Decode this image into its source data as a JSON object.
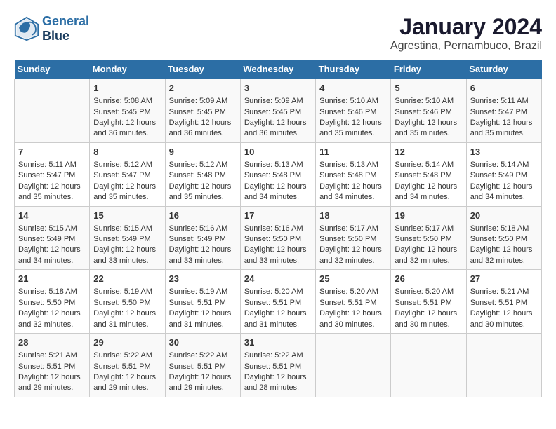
{
  "header": {
    "logo_line1": "General",
    "logo_line2": "Blue",
    "month_year": "January 2024",
    "location": "Agrestina, Pernambuco, Brazil"
  },
  "days_of_week": [
    "Sunday",
    "Monday",
    "Tuesday",
    "Wednesday",
    "Thursday",
    "Friday",
    "Saturday"
  ],
  "weeks": [
    [
      {
        "day": "",
        "info": ""
      },
      {
        "day": "1",
        "sunrise": "Sunrise: 5:08 AM",
        "sunset": "Sunset: 5:45 PM",
        "daylight": "Daylight: 12 hours and 36 minutes."
      },
      {
        "day": "2",
        "sunrise": "Sunrise: 5:09 AM",
        "sunset": "Sunset: 5:45 PM",
        "daylight": "Daylight: 12 hours and 36 minutes."
      },
      {
        "day": "3",
        "sunrise": "Sunrise: 5:09 AM",
        "sunset": "Sunset: 5:45 PM",
        "daylight": "Daylight: 12 hours and 36 minutes."
      },
      {
        "day": "4",
        "sunrise": "Sunrise: 5:10 AM",
        "sunset": "Sunset: 5:46 PM",
        "daylight": "Daylight: 12 hours and 35 minutes."
      },
      {
        "day": "5",
        "sunrise": "Sunrise: 5:10 AM",
        "sunset": "Sunset: 5:46 PM",
        "daylight": "Daylight: 12 hours and 35 minutes."
      },
      {
        "day": "6",
        "sunrise": "Sunrise: 5:11 AM",
        "sunset": "Sunset: 5:47 PM",
        "daylight": "Daylight: 12 hours and 35 minutes."
      }
    ],
    [
      {
        "day": "7",
        "sunrise": "Sunrise: 5:11 AM",
        "sunset": "Sunset: 5:47 PM",
        "daylight": "Daylight: 12 hours and 35 minutes."
      },
      {
        "day": "8",
        "sunrise": "Sunrise: 5:12 AM",
        "sunset": "Sunset: 5:47 PM",
        "daylight": "Daylight: 12 hours and 35 minutes."
      },
      {
        "day": "9",
        "sunrise": "Sunrise: 5:12 AM",
        "sunset": "Sunset: 5:48 PM",
        "daylight": "Daylight: 12 hours and 35 minutes."
      },
      {
        "day": "10",
        "sunrise": "Sunrise: 5:13 AM",
        "sunset": "Sunset: 5:48 PM",
        "daylight": "Daylight: 12 hours and 34 minutes."
      },
      {
        "day": "11",
        "sunrise": "Sunrise: 5:13 AM",
        "sunset": "Sunset: 5:48 PM",
        "daylight": "Daylight: 12 hours and 34 minutes."
      },
      {
        "day": "12",
        "sunrise": "Sunrise: 5:14 AM",
        "sunset": "Sunset: 5:48 PM",
        "daylight": "Daylight: 12 hours and 34 minutes."
      },
      {
        "day": "13",
        "sunrise": "Sunrise: 5:14 AM",
        "sunset": "Sunset: 5:49 PM",
        "daylight": "Daylight: 12 hours and 34 minutes."
      }
    ],
    [
      {
        "day": "14",
        "sunrise": "Sunrise: 5:15 AM",
        "sunset": "Sunset: 5:49 PM",
        "daylight": "Daylight: 12 hours and 34 minutes."
      },
      {
        "day": "15",
        "sunrise": "Sunrise: 5:15 AM",
        "sunset": "Sunset: 5:49 PM",
        "daylight": "Daylight: 12 hours and 33 minutes."
      },
      {
        "day": "16",
        "sunrise": "Sunrise: 5:16 AM",
        "sunset": "Sunset: 5:49 PM",
        "daylight": "Daylight: 12 hours and 33 minutes."
      },
      {
        "day": "17",
        "sunrise": "Sunrise: 5:16 AM",
        "sunset": "Sunset: 5:50 PM",
        "daylight": "Daylight: 12 hours and 33 minutes."
      },
      {
        "day": "18",
        "sunrise": "Sunrise: 5:17 AM",
        "sunset": "Sunset: 5:50 PM",
        "daylight": "Daylight: 12 hours and 32 minutes."
      },
      {
        "day": "19",
        "sunrise": "Sunrise: 5:17 AM",
        "sunset": "Sunset: 5:50 PM",
        "daylight": "Daylight: 12 hours and 32 minutes."
      },
      {
        "day": "20",
        "sunrise": "Sunrise: 5:18 AM",
        "sunset": "Sunset: 5:50 PM",
        "daylight": "Daylight: 12 hours and 32 minutes."
      }
    ],
    [
      {
        "day": "21",
        "sunrise": "Sunrise: 5:18 AM",
        "sunset": "Sunset: 5:50 PM",
        "daylight": "Daylight: 12 hours and 32 minutes."
      },
      {
        "day": "22",
        "sunrise": "Sunrise: 5:19 AM",
        "sunset": "Sunset: 5:50 PM",
        "daylight": "Daylight: 12 hours and 31 minutes."
      },
      {
        "day": "23",
        "sunrise": "Sunrise: 5:19 AM",
        "sunset": "Sunset: 5:51 PM",
        "daylight": "Daylight: 12 hours and 31 minutes."
      },
      {
        "day": "24",
        "sunrise": "Sunrise: 5:20 AM",
        "sunset": "Sunset: 5:51 PM",
        "daylight": "Daylight: 12 hours and 31 minutes."
      },
      {
        "day": "25",
        "sunrise": "Sunrise: 5:20 AM",
        "sunset": "Sunset: 5:51 PM",
        "daylight": "Daylight: 12 hours and 30 minutes."
      },
      {
        "day": "26",
        "sunrise": "Sunrise: 5:20 AM",
        "sunset": "Sunset: 5:51 PM",
        "daylight": "Daylight: 12 hours and 30 minutes."
      },
      {
        "day": "27",
        "sunrise": "Sunrise: 5:21 AM",
        "sunset": "Sunset: 5:51 PM",
        "daylight": "Daylight: 12 hours and 30 minutes."
      }
    ],
    [
      {
        "day": "28",
        "sunrise": "Sunrise: 5:21 AM",
        "sunset": "Sunset: 5:51 PM",
        "daylight": "Daylight: 12 hours and 29 minutes."
      },
      {
        "day": "29",
        "sunrise": "Sunrise: 5:22 AM",
        "sunset": "Sunset: 5:51 PM",
        "daylight": "Daylight: 12 hours and 29 minutes."
      },
      {
        "day": "30",
        "sunrise": "Sunrise: 5:22 AM",
        "sunset": "Sunset: 5:51 PM",
        "daylight": "Daylight: 12 hours and 29 minutes."
      },
      {
        "day": "31",
        "sunrise": "Sunrise: 5:22 AM",
        "sunset": "Sunset: 5:51 PM",
        "daylight": "Daylight: 12 hours and 28 minutes."
      },
      {
        "day": "",
        "info": ""
      },
      {
        "day": "",
        "info": ""
      },
      {
        "day": "",
        "info": ""
      }
    ]
  ]
}
